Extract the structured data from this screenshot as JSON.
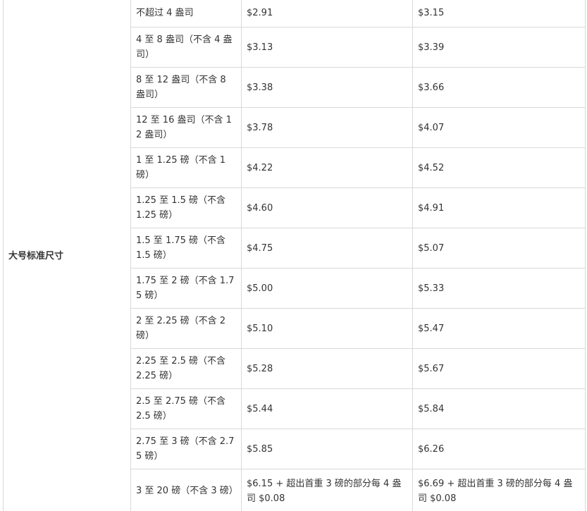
{
  "table": {
    "tier_label": "大号标准尺寸",
    "rows": [
      {
        "weight": "不超过 4 盎司",
        "fee_a": "$2.91",
        "fee_b": "$3.15"
      },
      {
        "weight": "4 至 8 盎司（不含 4 盎司）",
        "fee_a": "$3.13",
        "fee_b": "$3.39"
      },
      {
        "weight": "8 至 12 盎司（不含 8 盎司）",
        "fee_a": "$3.38",
        "fee_b": "$3.66"
      },
      {
        "weight": "12 至 16 盎司（不含 12 盎司）",
        "fee_a": "$3.78",
        "fee_b": "$4.07"
      },
      {
        "weight": "1 至 1.25 磅（不含 1 磅）",
        "fee_a": "$4.22",
        "fee_b": "$4.52"
      },
      {
        "weight": "1.25 至 1.5 磅（不含 1.25 磅）",
        "fee_a": "$4.60",
        "fee_b": "$4.91"
      },
      {
        "weight": "1.5 至 1.75 磅（不含 1.5 磅）",
        "fee_a": "$4.75",
        "fee_b": "$5.07"
      },
      {
        "weight": "1.75 至 2 磅（不含 1.75 磅）",
        "fee_a": "$5.00",
        "fee_b": "$5.33"
      },
      {
        "weight": "2 至 2.25 磅（不含 2 磅）",
        "fee_a": "$5.10",
        "fee_b": "$5.47"
      },
      {
        "weight": "2.25 至 2.5 磅（不含 2.25 磅）",
        "fee_a": "$5.28",
        "fee_b": "$5.67"
      },
      {
        "weight": "2.5 至 2.75 磅（不含 2.5 磅）",
        "fee_a": "$5.44",
        "fee_b": "$5.84"
      },
      {
        "weight": "2.75 至 3 磅（不含 2.75 磅）",
        "fee_a": "$5.85",
        "fee_b": "$6.26"
      },
      {
        "weight": "3 至 20 磅（不含 3 磅）",
        "fee_a": "$6.15 + 超出首重 3 磅的部分每 4 盎司 $0.08",
        "fee_b": "$6.69 + 超出首重 3 磅的部分每 4 盎司 $0.08"
      }
    ]
  }
}
